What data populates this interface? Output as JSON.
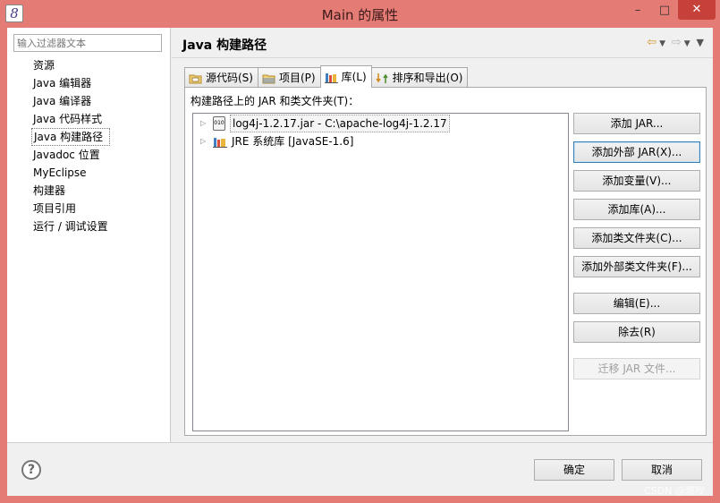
{
  "window": {
    "title": "Main 的属性",
    "app_icon_glyph": "8",
    "minimize": "–",
    "maximize": "□",
    "close": "✕"
  },
  "filter": {
    "placeholder": "输入过滤器文本"
  },
  "nav": {
    "items": [
      "资源",
      "Java 编辑器",
      "Java 编译器",
      "Java 代码样式",
      "Java 构建路径",
      "Javadoc 位置",
      "MyEclipse",
      "构建器",
      "项目引用",
      "运行 / 调试设置"
    ],
    "selected_index": 4
  },
  "page": {
    "title": "Java 构建路径",
    "nav_icons": [
      "back-arrow-icon",
      "dropdown-icon",
      "forward-arrow-icon",
      "dropdown-icon",
      "view-menu-icon"
    ]
  },
  "tabs": [
    {
      "label": "源代码(S)",
      "icon": "source-folder-icon",
      "active": false
    },
    {
      "label": "项目(P)",
      "icon": "project-folder-icon",
      "active": false
    },
    {
      "label": "库(L)",
      "icon": "library-icon",
      "active": true
    },
    {
      "label": "排序和导出(O)",
      "icon": "order-export-icon",
      "active": false
    }
  ],
  "libraries": {
    "section_label": "构建路径上的 JAR 和类文件夹(T)：",
    "entries": [
      {
        "label": "log4j-1.2.17.jar  -  C:\\apache-log4j-1.2.17",
        "icon": "jar-icon",
        "selected": true
      },
      {
        "label": "JRE 系统库 [JavaSE-1.6]",
        "icon": "library-icon",
        "selected": false
      }
    ],
    "jar_icon_text": "010"
  },
  "buttons": [
    {
      "label": "添加 JAR...",
      "state": "normal"
    },
    {
      "label": "添加外部 JAR(X)...",
      "state": "focused"
    },
    {
      "label": "添加变量(V)...",
      "state": "normal"
    },
    {
      "label": "添加库(A)...",
      "state": "normal"
    },
    {
      "label": "添加类文件夹(C)...",
      "state": "normal"
    },
    {
      "label": "添加外部类文件夹(F)...",
      "state": "normal"
    },
    {
      "label": "编辑(E)...",
      "state": "normal"
    },
    {
      "label": "除去(R)",
      "state": "normal"
    },
    {
      "label": "迁移 JAR 文件...",
      "state": "disabled"
    }
  ],
  "footer": {
    "help_glyph": "?",
    "ok_label": "确定",
    "cancel_label": "取消"
  },
  "watermark": "CSDN @燃吹"
}
